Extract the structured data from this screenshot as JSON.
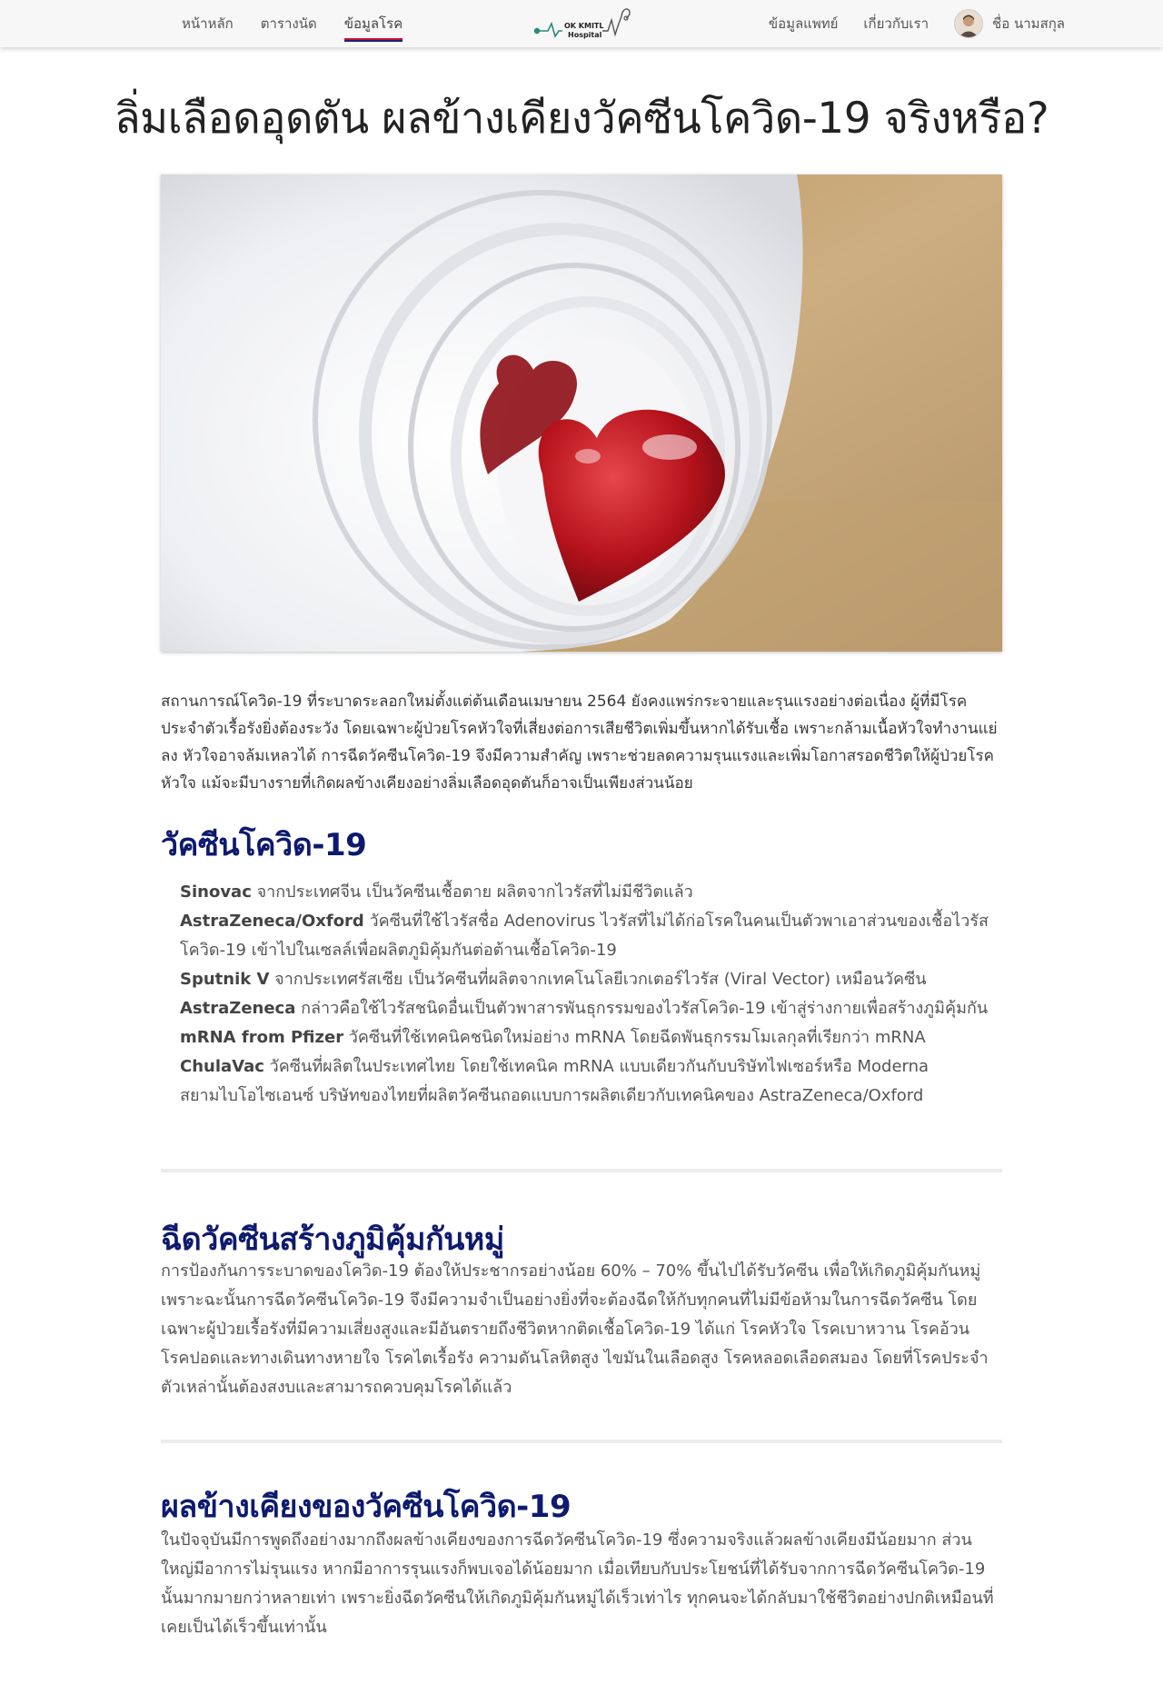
{
  "nav": {
    "home": "หน้าหลัก",
    "schedule": "ตารางนัด",
    "disease_info": "ข้อมูลโรค",
    "doctor_info": "ข้อมูลแพทย์",
    "about": "เกี่ยวกับเรา",
    "user_name": "ชื่อ นามสกุล",
    "logo_line1": "OK KMITL",
    "logo_line2": "Hospital"
  },
  "article": {
    "title": "ลิ่มเลือดอุดตัน ผลข้างเคียงวัคซีนโควิด-19 จริงหรือ?",
    "intro": "สถานการณ์โควิด-19 ที่ระบาดระลอกใหม่ตั้งแต่ต้นเดือนเมษายน 2564 ยังคงแพร่กระจายและรุนแรงอย่างต่อเนื่อง ผู้ที่มีโรคประจำตัวเรื้อรังยิ่งต้องระวัง โดยเฉพาะผู้ป่วยโรคหัวใจที่เสี่ยงต่อการเสียชีวิตเพิ่มขึ้นหากได้รับเชื้อ เพราะกล้ามเนื้อหัวใจทำงานแย่ลง หัวใจอาจล้มเหลวได้ การฉีดวัคซีนโควิด-19 จึงมีความสำคัญ เพราะช่วยลดความรุนแรงและเพิ่มโอกาสรอดชีวิตให้ผู้ป่วยโรคหัวใจ แม้จะมีบางรายที่เกิดผลข้างเคียงอย่างลิ่มเลือดอุดตันก็อาจเป็นเพียงส่วนน้อย",
    "section1": {
      "heading": "วัคซีนโควิด-19",
      "items": [
        {
          "name": "Sinovac",
          "text": " จากประเทศจีน เป็นวัคซีนเชื้อตาย ผลิตจากไวรัสที่ไม่มีชีวิตแล้ว"
        },
        {
          "name": "AstraZeneca/Oxford",
          "text": " วัคซีนที่ใช้ไวรัสชื่อ Adenovirus ไวรัสที่ไม่ได้ก่อโรคในคนเป็นตัวพาเอาส่วนของเชื้อไวรัสโควิด-19 เข้าไปในเซลล์เพื่อผลิตภูมิคุ้มกันต่อต้านเชื้อโควิด-19"
        },
        {
          "name": "Sputnik V",
          "text": " จากประเทศรัสเซีย เป็นวัคซีนที่ผลิตจากเทคโนโลยีเวกเตอร์ไวรัส (Viral Vector) เหมือนวัคซีน"
        },
        {
          "name": "AstraZeneca",
          "text": " กล่าวคือใช้ไวรัสชนิดอื่นเป็นตัวพาสารพันธุกรรมของไวรัสโควิด-19 เข้าสู่ร่างกายเพื่อสร้างภูมิคุ้มกัน"
        },
        {
          "name": "mRNA from Pfizer",
          "text": " วัคซีนที่ใช้เทคนิคชนิดใหม่อย่าง mRNA โดยฉีดพันธุกรรมโมเลกุลที่เรียกว่า mRNA"
        },
        {
          "name": "ChulaVac",
          "text": " วัคซีนที่ผลิตในประเทศไทย โดยใช้เทคนิค mRNA แบบเดียวกันกับบริษัทไฟเซอร์หรือ Moderna"
        },
        {
          "name": "",
          "text": "สยามไบโอไซเอนซ์ บริษัทของไทยที่ผลิตวัคซีนถอดแบบการผลิตเดียวกับเทคนิคของ AstraZeneca/Oxford"
        }
      ]
    },
    "section2": {
      "heading": "ฉีดวัคซีนสร้างภูมิคุ้มกันหมู่",
      "text": "การป้องกันการระบาดของโควิด-19 ต้องให้ประชากรอย่างน้อย 60% – 70% ขึ้นไปได้รับวัคซีน เพื่อให้เกิดภูมิคุ้มกันหมู่ เพราะฉะนั้นการฉีดวัคซีนโควิด-19 จึงมีความจำเป็นอย่างยิ่งที่จะต้องฉีดให้กับทุกคนที่ไม่มีข้อห้ามในการฉีดวัคซีน โดยเฉพาะผู้ป่วยเรื้อรังที่มีความเสี่ยงสูงและมีอันตรายถึงชีวิตหากติดเชื้อโควิด-19 ได้แก่ โรคหัวใจ โรคเบาหวาน โรคอ้วน โรคปอดและทางเดินทางหายใจ โรคไตเรื้อรัง ความดันโลหิตสูง ไขมันในเลือดสูง โรคหลอดเลือดสมอง โดยที่โรคประจำตัวเหล่านั้นต้องสงบและสามารถควบคุมโรคได้แล้ว"
    },
    "section3": {
      "heading": "ผลข้างเคียงของวัคซีนโควิด-19",
      "text": "ในปัจจุบันมีการพูดถึงอย่างมากถึงผลข้างเคียงของการฉีดวัคซีนโควิด-19 ซึ่งความจริงแล้วผลข้างเคียงมีน้อยมาก ส่วนใหญ่มีอาการไม่รุนแรง หากมีอาการรุนแรงก็พบเจอได้น้อยมาก เมื่อเทียบกับประโยชน์ที่ได้รับจากการฉีดวัคซีนโควิด-19 นั้นมากมายกว่าหลายเท่า เพราะยิ่งฉีดวัคซีนให้เกิดภูมิคุ้มกันหมู่ได้เร็วเท่าไร ทุกคนจะได้กลับมาใช้ชีวิตอย่างปกติเหมือนที่เคยเป็นได้เร็วขึ้นเท่านั้น"
    }
  },
  "colors": {
    "heading_navy": "#0d1a6e",
    "nav_underline_red": "#c8102e",
    "nav_underline_navy": "#1a237e",
    "pill_red": "#b5121b",
    "bottle_white": "#f4f4f6",
    "table_tan": "#c9a878"
  }
}
